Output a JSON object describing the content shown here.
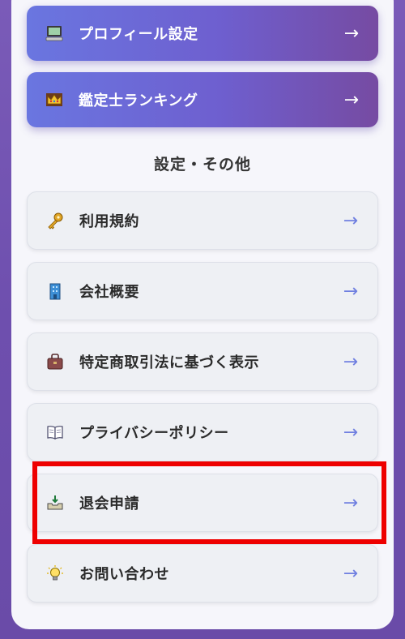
{
  "top_menu": [
    {
      "label": "プロフィール設定",
      "icon": "computer-icon",
      "arrow": "→"
    },
    {
      "label": "鑑定士ランキング",
      "icon": "crown-icon",
      "arrow": "→"
    }
  ],
  "section": {
    "title": "設定・その他"
  },
  "settings_menu": [
    {
      "label": "利用規約",
      "icon": "key-icon",
      "arrow": "→"
    },
    {
      "label": "会社概要",
      "icon": "building-icon",
      "arrow": "→"
    },
    {
      "label": "特定商取引法に基づく表示",
      "icon": "briefcase-icon",
      "arrow": "→"
    },
    {
      "label": "プライバシーポリシー",
      "icon": "book-icon",
      "arrow": "→"
    },
    {
      "label": "退会申請",
      "icon": "inbox-tray-icon",
      "arrow": "→"
    },
    {
      "label": "お問い合わせ",
      "icon": "light-bulb-icon",
      "arrow": "→"
    }
  ],
  "colors": {
    "primary_gradient_start": "#6a76e0",
    "primary_gradient_end": "#764ba2",
    "highlight": "#ee0000",
    "arrow_accent": "#6f7fe0"
  }
}
